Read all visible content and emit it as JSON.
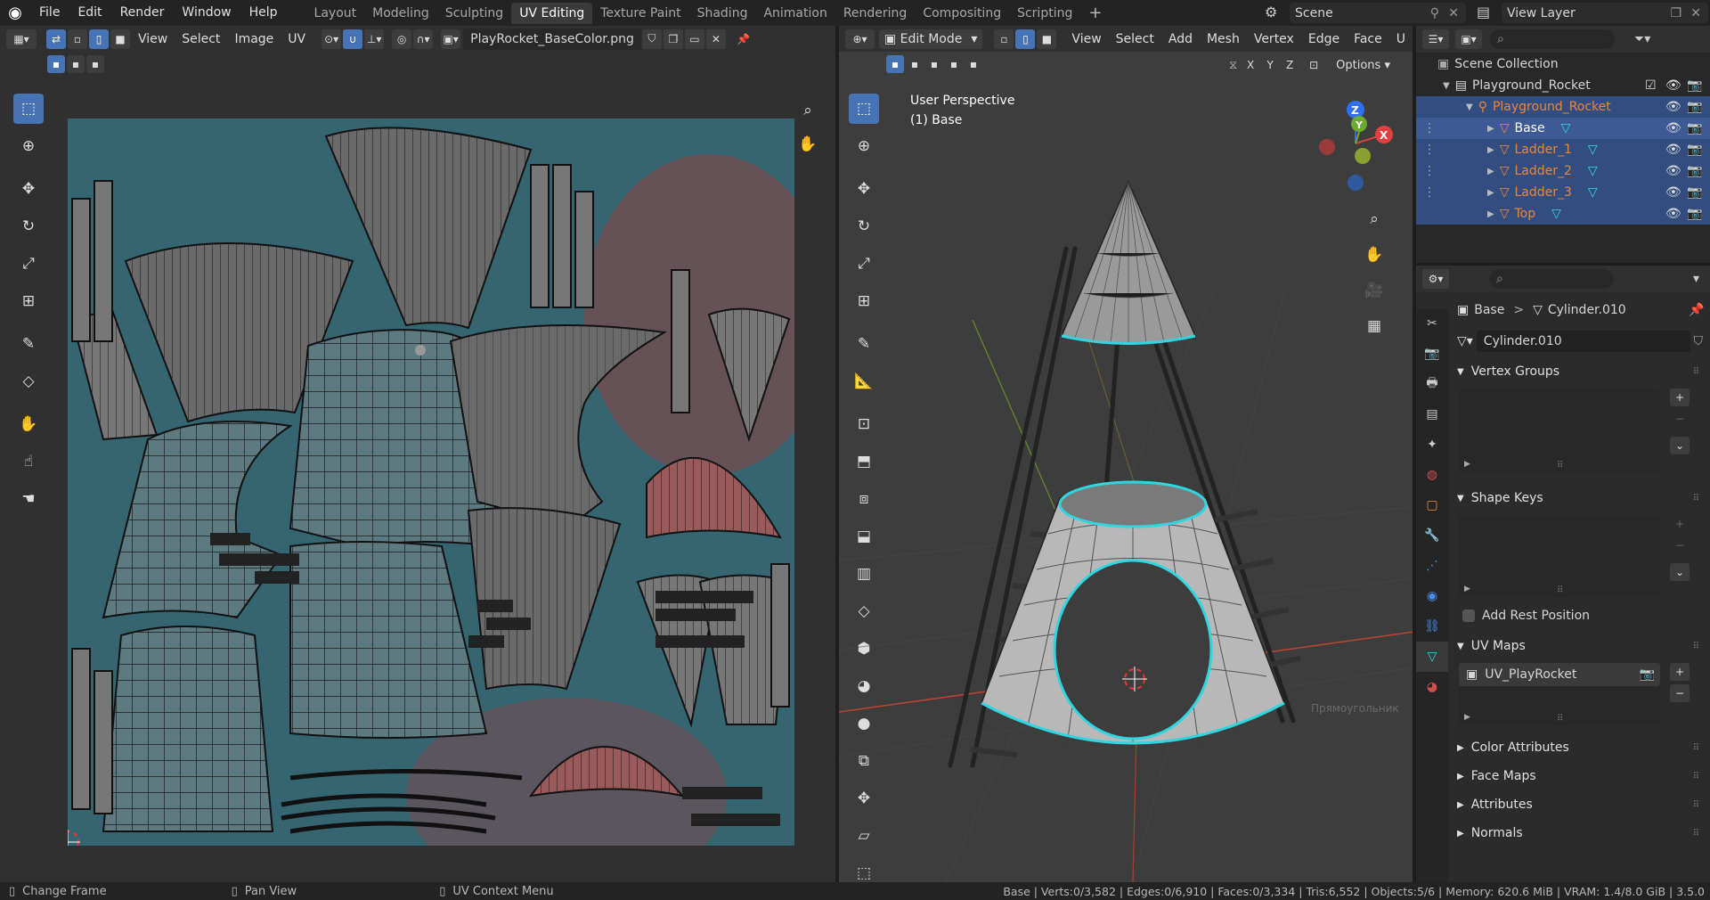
{
  "topbar": {
    "menu": [
      "File",
      "Edit",
      "Render",
      "Window",
      "Help"
    ],
    "workspaces": [
      "Layout",
      "Modeling",
      "Sculpting",
      "UV Editing",
      "Texture Paint",
      "Shading",
      "Animation",
      "Rendering",
      "Compositing",
      "Scripting"
    ],
    "active_workspace": "UV Editing",
    "add_tab": "+",
    "scene": "Scene",
    "view_layer": "View Layer"
  },
  "uv_editor": {
    "menu": [
      "View",
      "Select",
      "Image",
      "UV"
    ],
    "image_name": "PlayRocket_BaseColor.png"
  },
  "viewport": {
    "mode": "Edit Mode",
    "menu": [
      "View",
      "Select",
      "Add",
      "Mesh",
      "Vertex",
      "Edge",
      "Face",
      "U"
    ],
    "axes": [
      "X",
      "Y",
      "Z"
    ],
    "options": "Options",
    "info_line1": "User Perspective",
    "info_line2": "(1) Base",
    "gizmo_z": "Z",
    "gizmo_y": "Y",
    "gizmo_x": "X",
    "tooltip_ghost": "Прямоугольник"
  },
  "outliner": {
    "root": "Scene Collection",
    "items": [
      {
        "label": "Playground_Rocket",
        "type": "collection"
      },
      {
        "label": "Playground_Rocket",
        "type": "armature"
      },
      {
        "label": "Base",
        "type": "mesh"
      },
      {
        "label": "Ladder_1",
        "type": "mesh"
      },
      {
        "label": "Ladder_2",
        "type": "mesh"
      },
      {
        "label": "Ladder_3",
        "type": "mesh"
      },
      {
        "label": "Top",
        "type": "mesh"
      }
    ]
  },
  "properties": {
    "breadcrumb_object": "Base",
    "breadcrumb_sep": ">",
    "breadcrumb_data": "Cylinder.010",
    "datablock": "Cylinder.010",
    "sections": {
      "vertex_groups": "Vertex Groups",
      "shape_keys": "Shape Keys",
      "add_rest_position": "Add Rest Position",
      "uv_maps": "UV Maps",
      "uv_map_item": "UV_PlayRocket",
      "color_attributes": "Color Attributes",
      "face_maps": "Face Maps",
      "attributes": "Attributes",
      "normals": "Normals"
    }
  },
  "statusbar": {
    "change_frame": "Change Frame",
    "pan_view": "Pan View",
    "uv_context": "UV Context Menu",
    "stats": "Base | Verts:0/3,582 | Edges:0/6,910 | Faces:0/3,334 | Tris:6,552 | Objects:5/6 | Memory: 620.6 MiB | VRAM: 1.4/8.0 GiB | 3.5.0"
  },
  "colors": {
    "accent": "#4772b3",
    "selection_cyan": "#2fd6e0",
    "object_orange": "#e8873a",
    "outliner_select": "#334d80"
  }
}
